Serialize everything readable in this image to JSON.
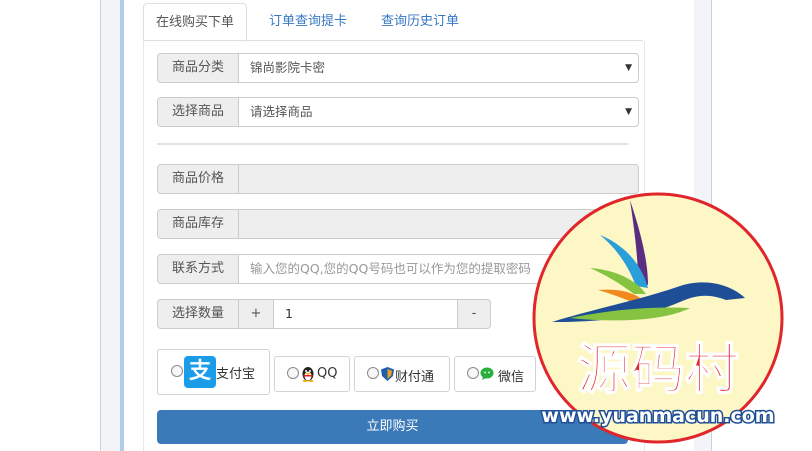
{
  "tabs": [
    {
      "label": "在线购买下单",
      "active": true
    },
    {
      "label": "订单查询提卡",
      "active": false
    },
    {
      "label": "查询历史订单",
      "active": false
    }
  ],
  "form": {
    "category": {
      "label": "商品分类",
      "value": "锦尚影院卡密"
    },
    "product": {
      "label": "选择商品",
      "value": "请选择商品"
    },
    "price": {
      "label": "商品价格",
      "value": ""
    },
    "stock": {
      "label": "商品库存",
      "value": ""
    },
    "contact": {
      "label": "联系方式",
      "placeholder": "输入您的QQ,您的QQ号码也可以作为您的提取密码"
    },
    "quantity": {
      "label": "选择数量",
      "plus": "+",
      "value": "1",
      "minus": "-"
    }
  },
  "payment": {
    "options": [
      {
        "label": "支付宝",
        "icon": "alipay-icon",
        "logo_char": "支",
        "color": "#1a9ce8"
      },
      {
        "label": "QQ",
        "icon": "qq-penguin-icon"
      },
      {
        "label": "财付通",
        "icon": "tenpay-icon"
      },
      {
        "label": "微信",
        "icon": "wechat-icon",
        "color": "#2aae3c"
      }
    ]
  },
  "buy_button": "立即购买",
  "watermark": {
    "brand": "源码村",
    "url": "www.yuanmacun.com"
  },
  "colors": {
    "accent_blue": "#3a7ab8",
    "tab_link": "#3778c4",
    "watermark_red": "#e0252b",
    "watermark_bg": "#fdf6c5"
  }
}
